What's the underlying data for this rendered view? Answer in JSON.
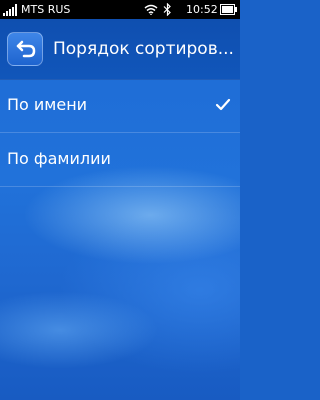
{
  "status_bar": {
    "carrier": "MTS RUS",
    "time": "10:52",
    "icons": [
      "signal-icon",
      "wifi-icon",
      "bluetooth-icon",
      "battery-icon"
    ]
  },
  "header": {
    "title": "Порядок сортиров...",
    "back_icon": "back-arrow-icon"
  },
  "options": [
    {
      "label": "По имени",
      "selected": true
    },
    {
      "label": "По фамилии",
      "selected": false
    }
  ],
  "colors": {
    "background": "#1d6ad4",
    "header": "#1156ba",
    "status_bar": "#000000"
  }
}
